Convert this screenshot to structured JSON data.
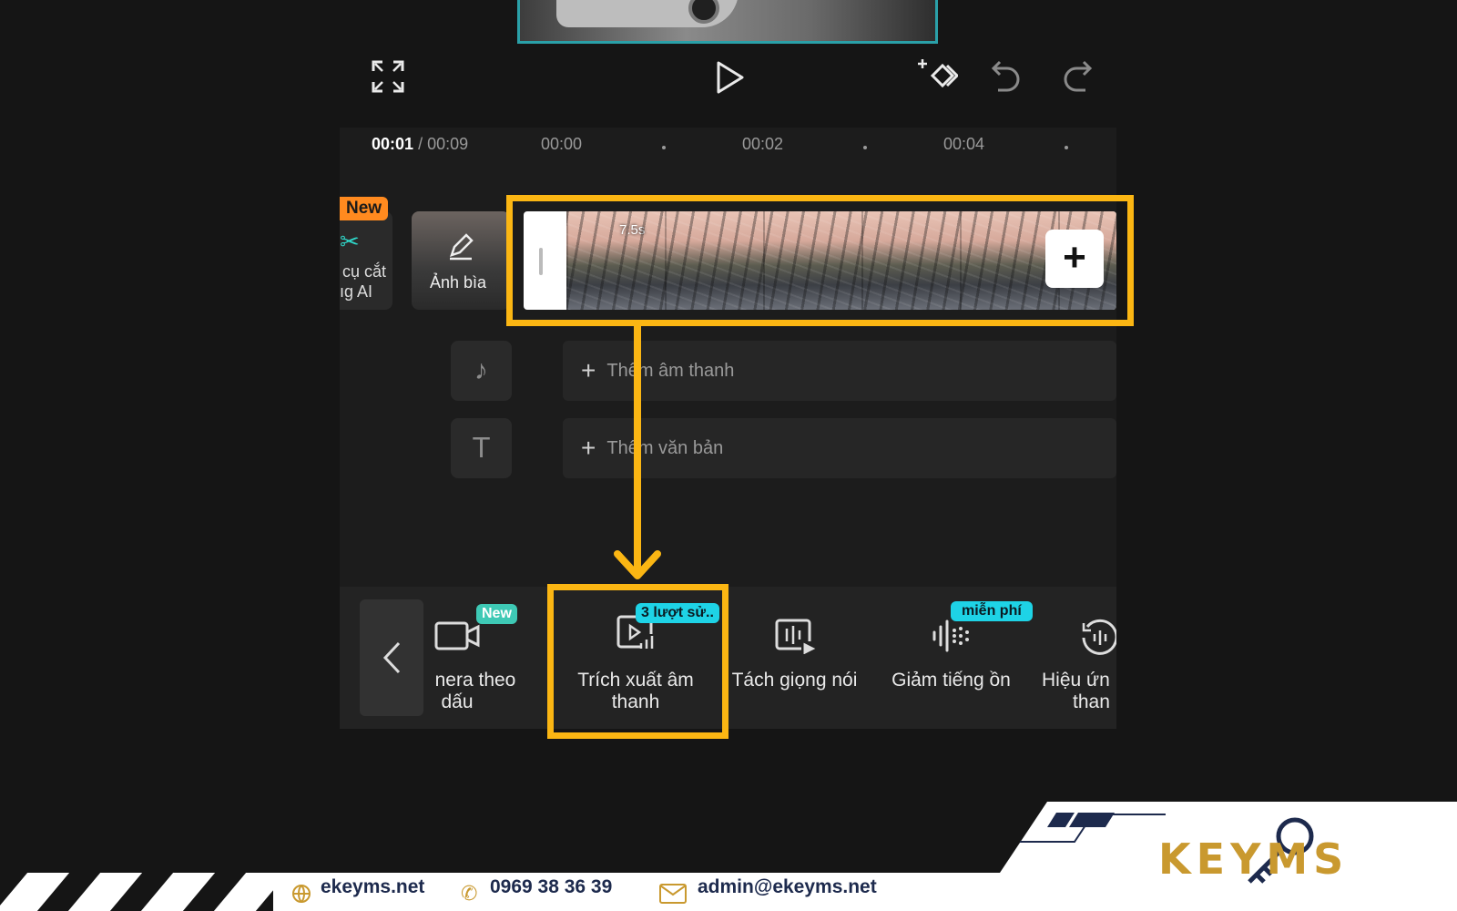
{
  "toolbar_top": {
    "icons": [
      "fullscreen-icon",
      "play-icon",
      "keyframe-icon",
      "undo-icon",
      "redo-icon"
    ]
  },
  "timeline": {
    "current_time": "00:01",
    "total_time": "/ 00:09",
    "ticks": [
      "00:00",
      "00:02",
      "00:04"
    ]
  },
  "side_tools": {
    "new_badge": "New",
    "ai_cut_label_1": "cụ cắt",
    "ai_cut_label_2": "ıg AI",
    "cover_label": "Ảnh bìa"
  },
  "clip": {
    "duration": "7.5s",
    "add_label": "+"
  },
  "tracks": {
    "audio_add": "Thêm âm thanh",
    "text_add": "Thêm văn bản"
  },
  "bottom_tools": {
    "back_label": "‹",
    "items": [
      {
        "label_1": "nera theo",
        "label_2": "dấu",
        "badge": "New"
      },
      {
        "label_1": "Trích xuất âm",
        "label_2": "thanh",
        "badge": "3 lượt sử.."
      },
      {
        "label_1": "Tách giọng nói",
        "label_2": ""
      },
      {
        "label_1": "Giảm tiếng ồn",
        "label_2": "",
        "badge": "miễn phí"
      },
      {
        "label_1": "Hiệu ứn",
        "label_2": "than"
      }
    ]
  },
  "footer": {
    "website": "ekeyms.net",
    "phone": "0969 38 36 39",
    "email": "admin@ekeyms.net",
    "logo_text": "KEYMS"
  },
  "colors": {
    "highlight": "#fbb613",
    "badge_new": "#3ec9b5",
    "badge_cyan": "#1ed3e6",
    "badge_orange": "#ff8a1f",
    "brand_navy": "#1d2a4d",
    "brand_gold": "#c9992f"
  }
}
